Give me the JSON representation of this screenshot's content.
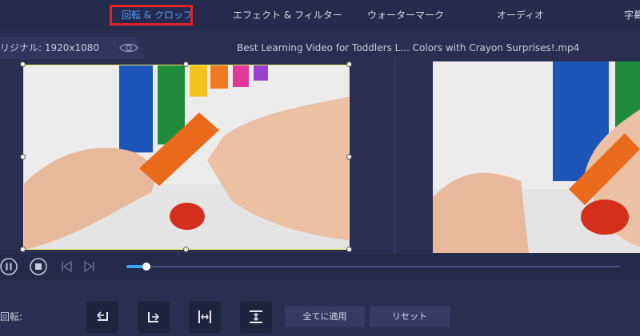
{
  "tabs": [
    {
      "label": "回転 & クロップ",
      "active": true
    },
    {
      "label": "エフェクト & フィルター",
      "active": false
    },
    {
      "label": "ウォーターマーク",
      "active": false
    },
    {
      "label": "オーディオ",
      "active": false
    },
    {
      "label": "字幕",
      "active": false
    }
  ],
  "info": {
    "origin_label": "リジナル: 1920x1080",
    "filename": "Best Learning Video for Toddlers L... Colors with Crayon Surprises!.mp4"
  },
  "player": {
    "progress": 0.04
  },
  "rotation": {
    "label": "回転:",
    "apply_all": "全てに適用",
    "reset": "リセット"
  },
  "colors": {
    "accent": "#4e9dff",
    "highlight_box": "#e0202a",
    "crop_border": "#e6ee5a",
    "background": "#2a2f52"
  }
}
